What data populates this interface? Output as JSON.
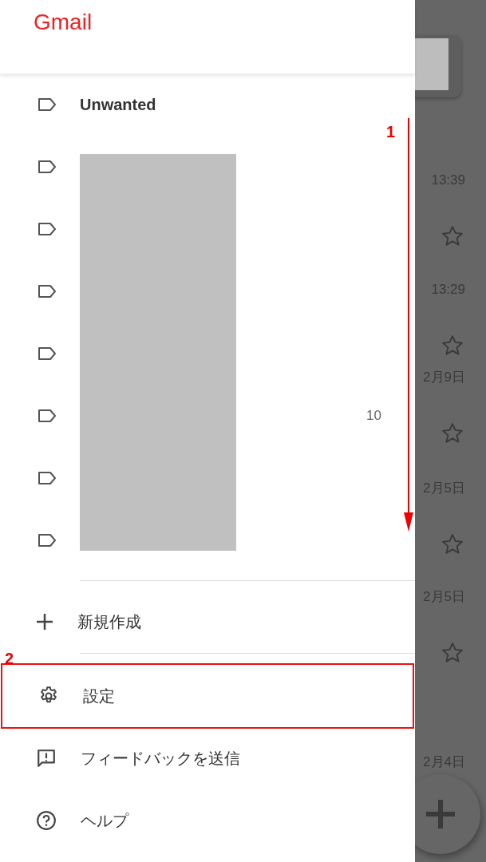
{
  "app_title": "Gmail",
  "labels": [
    {
      "name": "Unwanted",
      "redacted": false
    },
    {
      "redacted": true
    },
    {
      "redacted": true
    },
    {
      "redacted": true
    },
    {
      "redacted": true
    },
    {
      "redacted": true,
      "count": "10"
    },
    {
      "redacted": true
    },
    {
      "redacted": true
    }
  ],
  "menu_items": [
    {
      "kind": "create",
      "label": "新規作成",
      "highlighted": false
    },
    {
      "kind": "settings",
      "label": "設定",
      "highlighted": true
    },
    {
      "kind": "feedback",
      "label": "フィードバックを送信",
      "highlighted": false
    },
    {
      "kind": "help",
      "label": "ヘルプ",
      "highlighted": false
    }
  ],
  "background_list": [
    {
      "time": "13:39",
      "starred": false
    },
    {
      "time": "13:29",
      "starred": false
    },
    {
      "time": "2月9日",
      "starred": false
    },
    {
      "time": "2月5日",
      "starred": false
    },
    {
      "time": "2月5日",
      "starred": false
    },
    {
      "time": "2月4日"
    }
  ],
  "annotations": [
    {
      "kind": "arrow",
      "number": "1"
    },
    {
      "kind": "box",
      "number": "2"
    }
  ]
}
